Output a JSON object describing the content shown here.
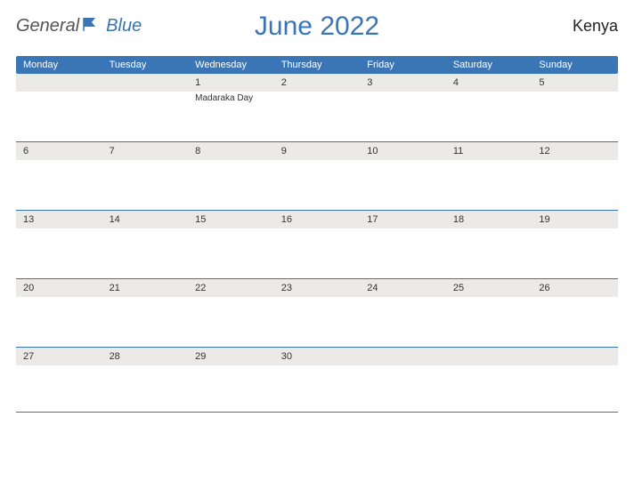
{
  "header": {
    "logo_part1": "General",
    "logo_part2": "Blue",
    "title": "June 2022",
    "country": "Kenya"
  },
  "days": [
    "Monday",
    "Tuesday",
    "Wednesday",
    "Thursday",
    "Friday",
    "Saturday",
    "Sunday"
  ],
  "weeks": [
    [
      {
        "num": "",
        "event": ""
      },
      {
        "num": "",
        "event": ""
      },
      {
        "num": "1",
        "event": "Madaraka Day"
      },
      {
        "num": "2",
        "event": ""
      },
      {
        "num": "3",
        "event": ""
      },
      {
        "num": "4",
        "event": ""
      },
      {
        "num": "5",
        "event": ""
      }
    ],
    [
      {
        "num": "6",
        "event": ""
      },
      {
        "num": "7",
        "event": ""
      },
      {
        "num": "8",
        "event": ""
      },
      {
        "num": "9",
        "event": ""
      },
      {
        "num": "10",
        "event": ""
      },
      {
        "num": "11",
        "event": ""
      },
      {
        "num": "12",
        "event": ""
      }
    ],
    [
      {
        "num": "13",
        "event": ""
      },
      {
        "num": "14",
        "event": ""
      },
      {
        "num": "15",
        "event": ""
      },
      {
        "num": "16",
        "event": ""
      },
      {
        "num": "17",
        "event": ""
      },
      {
        "num": "18",
        "event": ""
      },
      {
        "num": "19",
        "event": ""
      }
    ],
    [
      {
        "num": "20",
        "event": ""
      },
      {
        "num": "21",
        "event": ""
      },
      {
        "num": "22",
        "event": ""
      },
      {
        "num": "23",
        "event": ""
      },
      {
        "num": "24",
        "event": ""
      },
      {
        "num": "25",
        "event": ""
      },
      {
        "num": "26",
        "event": ""
      }
    ],
    [
      {
        "num": "27",
        "event": ""
      },
      {
        "num": "28",
        "event": ""
      },
      {
        "num": "29",
        "event": ""
      },
      {
        "num": "30",
        "event": ""
      },
      {
        "num": "",
        "event": ""
      },
      {
        "num": "",
        "event": ""
      },
      {
        "num": "",
        "event": ""
      }
    ]
  ]
}
